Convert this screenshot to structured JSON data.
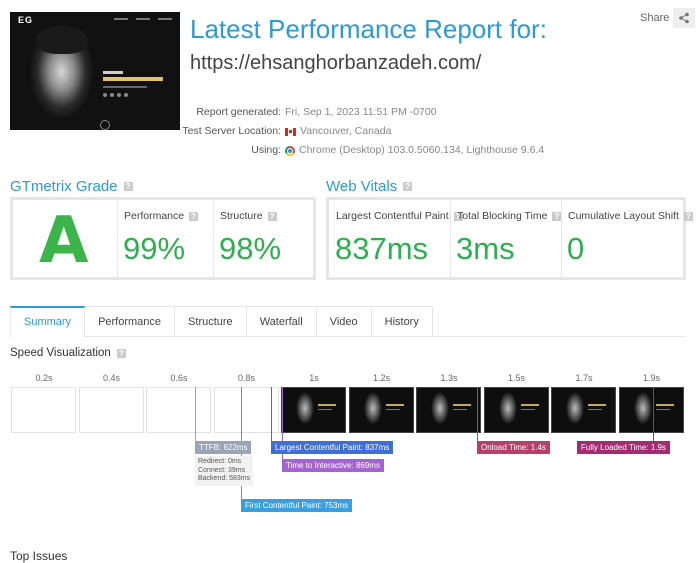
{
  "header": {
    "title": "Latest Performance Report for:",
    "url": "https://ehsanghorbanzadeh.com/",
    "share_label": "Share",
    "thumbnail": {
      "logo": "EG"
    }
  },
  "meta": {
    "rows": [
      {
        "label": "Report generated:",
        "value": "Fri, Sep 1, 2023 11:51 PM -0700"
      },
      {
        "label": "Test Server Location:",
        "value": "Vancouver, Canada",
        "icon": "canada-flag-icon"
      },
      {
        "label": "Using:",
        "value": "Chrome (Desktop) 103.0.5060.134, Lighthouse 9.6.4",
        "icon": "chrome-icon"
      }
    ]
  },
  "grade": {
    "heading": "GTmetrix Grade",
    "letter": "A",
    "performance_label": "Performance",
    "performance_value": "99%",
    "structure_label": "Structure",
    "structure_value": "98%"
  },
  "vitals": {
    "heading": "Web Vitals",
    "lcp_label": "Largest Contentful Paint",
    "lcp_value": "837ms",
    "tbt_label": "Total Blocking Time",
    "tbt_value": "3ms",
    "cls_label": "Cumulative Layout Shift",
    "cls_value": "0"
  },
  "colors": {
    "accent": "#2a9ad8",
    "good": "#2eaf4f",
    "ttfb": "#9aa4b4",
    "fcp": "#3a9ee0",
    "lcp": "#3f6fd0",
    "tti": "#a563d1",
    "onload": "#b5406a",
    "fully_loaded": "#a32c70"
  },
  "tabs": [
    "Summary",
    "Performance",
    "Structure",
    "Waterfall",
    "Video",
    "History"
  ],
  "active_tab": "Summary",
  "speed": {
    "heading": "Speed Visualization",
    "ticks": [
      "0.2s",
      "0.4s",
      "0.6s",
      "0.8s",
      "1s",
      "1.2s",
      "1.3s",
      "1.5s",
      "1.7s",
      "1.9s"
    ],
    "frames_blank": 4,
    "frames_total": 10,
    "markers": {
      "ttfb": "TTFB: 622ms",
      "ttfb_details": [
        "Redirect: 0ms",
        "Connect: 39ms",
        "Backend: 583ms"
      ],
      "fcp": "First Contentful Paint: 753ms",
      "lcp": "Largest Contentful Paint: 837ms",
      "tti": "Time to Interactive: 869ms",
      "onload": "Onload Time: 1.4s",
      "fully_loaded": "Fully Loaded Time: 1.9s"
    }
  },
  "top_issues_label": "Top Issues"
}
